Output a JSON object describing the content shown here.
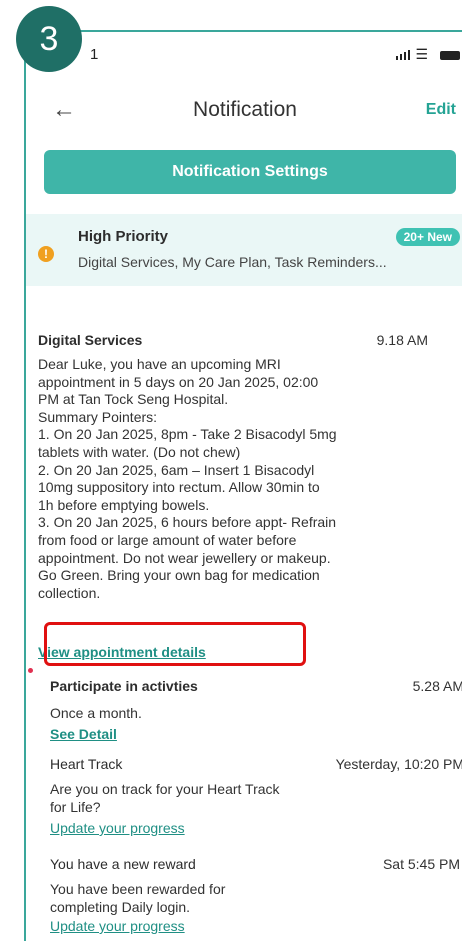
{
  "step_badge": "3",
  "status_bar": {
    "time": "1"
  },
  "header": {
    "title": "Notification",
    "edit_label": "Edit"
  },
  "settings_button": "Notification Settings",
  "priority": {
    "title": "High Priority",
    "badge": "20+ New",
    "subtitle": "Digital Services, My Care Plan, Task Reminders..."
  },
  "card": {
    "title": "Digital Services",
    "time": "9.18 AM",
    "body": "Dear Luke, you have an upcoming MRI\nappointment in 5 days on 20 Jan 2025, 02:00\nPM at Tan Tock Seng Hospital.\nSummary Pointers:\n1. On 20 Jan 2025, 8pm - Take 2 Bisacodyl 5mg\ntablets with water. (Do not chew)\n2. On 20 Jan 2025, 6am – Insert 1 Bisacodyl\n10mg suppository into rectum. Allow 30min to\n1h before emptying bowels.\n3. On 20 Jan 2025, 6 hours before appt- Refrain\nfrom food or large amount of water before\nappointment. Do not wear jewellery or makeup.\nGo Green. Bring your own bag for medication\ncollection.",
    "link": "View appointment details"
  },
  "items": [
    {
      "title": "Participate in activties",
      "time": "5.28 AM",
      "body": "Once a month.",
      "link": "See Detail"
    },
    {
      "title": "Heart Track",
      "time": "Yesterday, 10:20 PM",
      "body": "Are you on track for your Heart Track\nfor Life?",
      "link": "Update your progress"
    },
    {
      "title": "You have a new reward",
      "time": "Sat 5:45 PM",
      "body": "You have been rewarded for\ncompleting Daily login.",
      "link": "Update your progress"
    }
  ]
}
